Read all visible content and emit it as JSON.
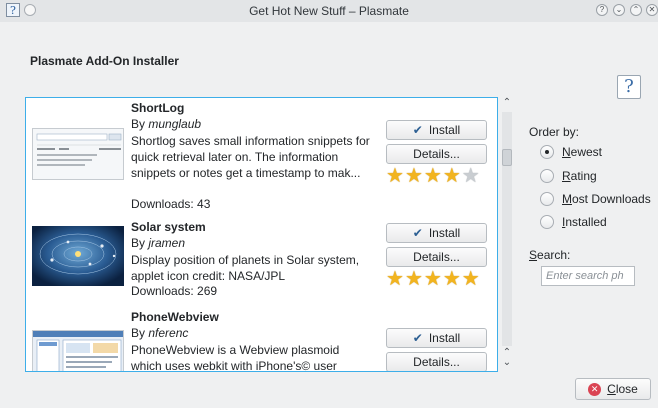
{
  "window": {
    "title": "Get Hot New Stuff – Plasmate",
    "help_glyph": "?",
    "buttons": [
      "?",
      "⌄",
      "⌃",
      "✕"
    ]
  },
  "header": {
    "title": "Plasmate Add-On Installer",
    "help_glyph": "?"
  },
  "items": [
    {
      "name": "ShortLog",
      "by": "By ",
      "author": "munglaub",
      "description": "Shortlog saves small information snippets for quick retrieval later on. The information snippets or notes get a timestamp to mak...",
      "downloads": "Downloads: 43",
      "install_label": "Install",
      "details_label": "Details...",
      "rating_stars": 4
    },
    {
      "name": "Solar system",
      "by": "By ",
      "author": "jramen",
      "description": "Display position of planets in Solar system, applet icon credit: NASA/JPL",
      "downloads": "Downloads: 269",
      "install_label": "Install",
      "details_label": "Details...",
      "rating_stars": 5
    },
    {
      "name": "PhoneWebview",
      "by": "By ",
      "author": "nferenc",
      "description": "PhoneWebview is a Webview plasmoid which uses webkit with iPhone's© user",
      "downloads": "",
      "install_label": "Install",
      "details_label": "Details...",
      "rating_stars": 0
    }
  ],
  "sidebar": {
    "order_label": "Order by:",
    "options": [
      {
        "first": "N",
        "rest": "ewest",
        "checked": true
      },
      {
        "first": "R",
        "rest": "ating",
        "checked": false
      },
      {
        "first": "M",
        "rest": "ost Downloads",
        "checked": false
      },
      {
        "first": "I",
        "rest": "nstalled",
        "checked": false
      }
    ],
    "search_first": "S",
    "search_rest": "earch:",
    "search_placeholder": "Enter search ph"
  },
  "footer": {
    "close_first": "C",
    "close_rest": "lose"
  },
  "colors": {
    "accent": "#3daee9",
    "star": "#f2b41f",
    "close_icon": "#da4453"
  }
}
